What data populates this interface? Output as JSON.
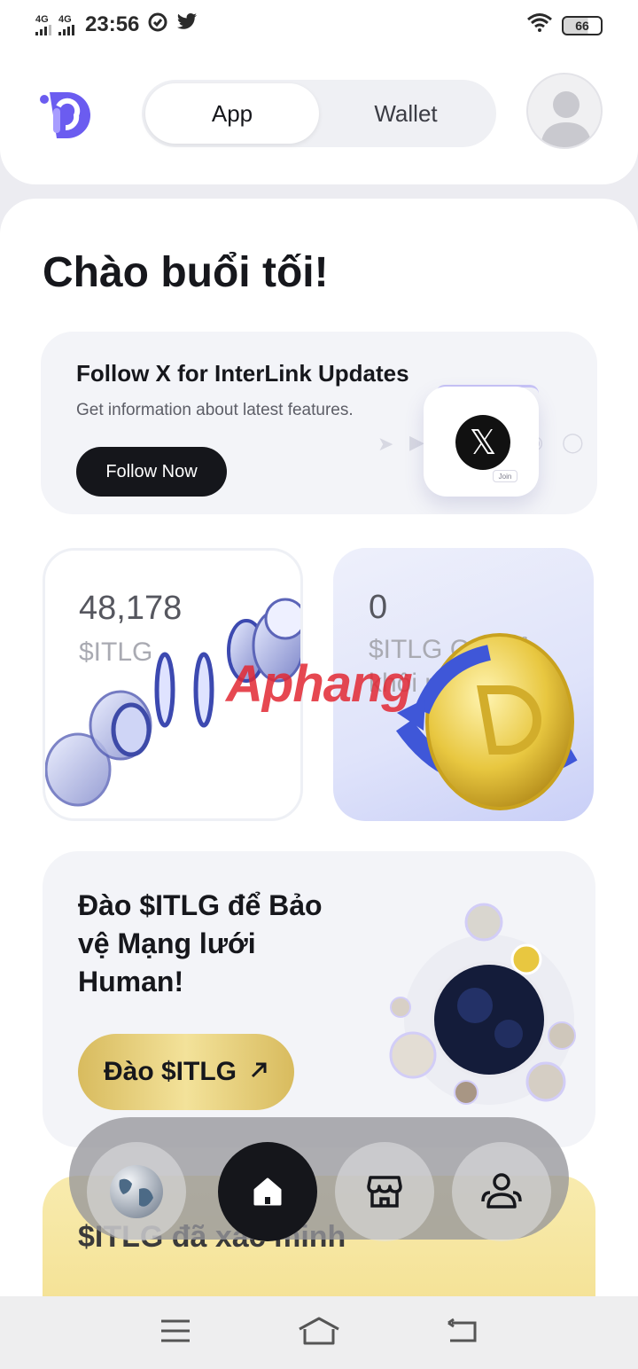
{
  "status_bar": {
    "signal_1": "4G",
    "signal_2": "4G",
    "time": "23:56",
    "battery": "66",
    "icons": [
      "signal-icon",
      "signal-icon",
      "sync-icon",
      "twitter-icon",
      "wifi-icon",
      "battery-icon"
    ]
  },
  "header": {
    "tabs": [
      {
        "label": "App",
        "active": true
      },
      {
        "label": "Wallet",
        "active": false
      }
    ]
  },
  "greeting": "Chào buổi tối!",
  "follow_card": {
    "title": "Follow X for InterLink Updates",
    "subtitle": "Get information about latest features.",
    "button": "Follow Now",
    "join_label": "Join"
  },
  "stats": [
    {
      "value": "48,178",
      "label": "$ITLG"
    },
    {
      "value": "0",
      "label": "$ITLG Có thể khôi phục"
    }
  ],
  "mine_card": {
    "title": "Đào $ITLG để Bảo vệ Mạng lưới Human!",
    "button": "Đào $ITLG"
  },
  "verified_card": {
    "title": "$ITLG đã xác minh"
  },
  "watermark": "Aphang",
  "bottom_nav": [
    {
      "icon": "globe-icon",
      "active": false
    },
    {
      "icon": "home-icon",
      "active": true
    },
    {
      "icon": "store-icon",
      "active": false
    },
    {
      "icon": "people-icon",
      "active": false
    }
  ],
  "colors": {
    "brand": "#6b5cf0",
    "dark_button": "#15161b",
    "gold": "#e8cf7a",
    "card_bg": "#f3f4f8"
  }
}
